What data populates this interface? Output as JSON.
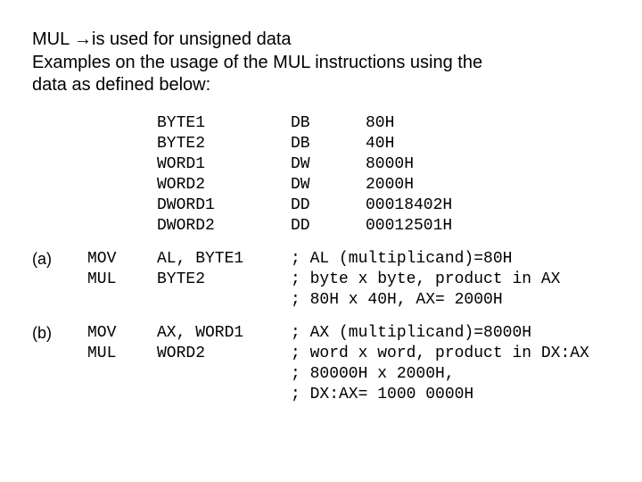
{
  "intro": {
    "line1_pre": "MUL ",
    "line1_post": "is used for unsigned data",
    "line2": "Examples on the usage of the MUL instructions using the",
    "line3": "data as defined below:"
  },
  "defs": [
    {
      "name": "BYTE1",
      "type": "DB",
      "val": "80H"
    },
    {
      "name": "BYTE2",
      "type": "DB",
      "val": "40H"
    },
    {
      "name": "WORD1",
      "type": "DW",
      "val": "8000H"
    },
    {
      "name": "WORD2",
      "type": "DW",
      "val": "2000H"
    },
    {
      "name": "DWORD1",
      "type": "DD",
      "val": "00018402H"
    },
    {
      "name": "DWORD2",
      "type": "DD",
      "val": "00012501H"
    }
  ],
  "examples": [
    {
      "label": "(a)",
      "lines": [
        {
          "op": "MOV",
          "arg": "AL, BYTE1",
          "cmt": "; AL (multiplicand)=80H"
        },
        {
          "op": "MUL",
          "arg": "BYTE2",
          "cmt": "; byte x byte, product in AX"
        },
        {
          "op": "",
          "arg": "",
          "cmt": "; 80H x 40H, AX= 2000H"
        }
      ]
    },
    {
      "label": "(b)",
      "lines": [
        {
          "op": "MOV",
          "arg": "AX, WORD1",
          "cmt": "; AX (multiplicand)=8000H"
        },
        {
          "op": "MUL",
          "arg": "WORD2",
          "cmt": "; word x word, product in DX:AX"
        },
        {
          "op": "",
          "arg": "",
          "cmt": "; 80000H x 2000H,"
        },
        {
          "op": "",
          "arg": "",
          "cmt": "; DX:AX= 1000 0000H"
        }
      ]
    }
  ]
}
